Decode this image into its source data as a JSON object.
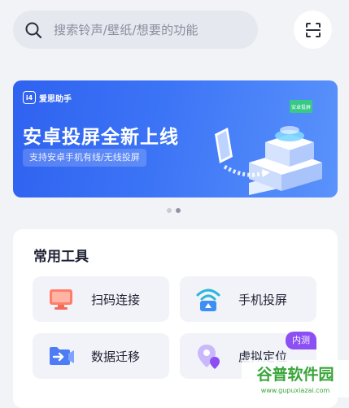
{
  "search": {
    "placeholder": "搜索铃声/壁纸/想要的功能",
    "icon": "search-icon"
  },
  "scan": {
    "icon": "scan-icon"
  },
  "banner": {
    "brand": "爱思助手",
    "logo_text": "i4",
    "headline": "安卓投屏全新上线",
    "subline": "支持安卓手机有线/无线投屏",
    "tag": "安卓投屏"
  },
  "carousel": {
    "count": 2,
    "active_index": 1
  },
  "tools": {
    "title": "常用工具",
    "items": [
      {
        "label": "扫码连接",
        "icon": "monitor-icon"
      },
      {
        "label": "手机投屏",
        "icon": "wifi-cast-icon"
      },
      {
        "label": "数据迁移",
        "icon": "folder-transfer-icon"
      },
      {
        "label": "虚拟定位",
        "icon": "location-pin-icon",
        "badge": "内测"
      }
    ]
  },
  "watermark": {
    "text": "谷普软件园",
    "url": "www.gupuxiazai.com"
  },
  "colors": {
    "background": "#f2f3f7",
    "banner": "#3c74f6",
    "badge": "#8c4ff4"
  }
}
